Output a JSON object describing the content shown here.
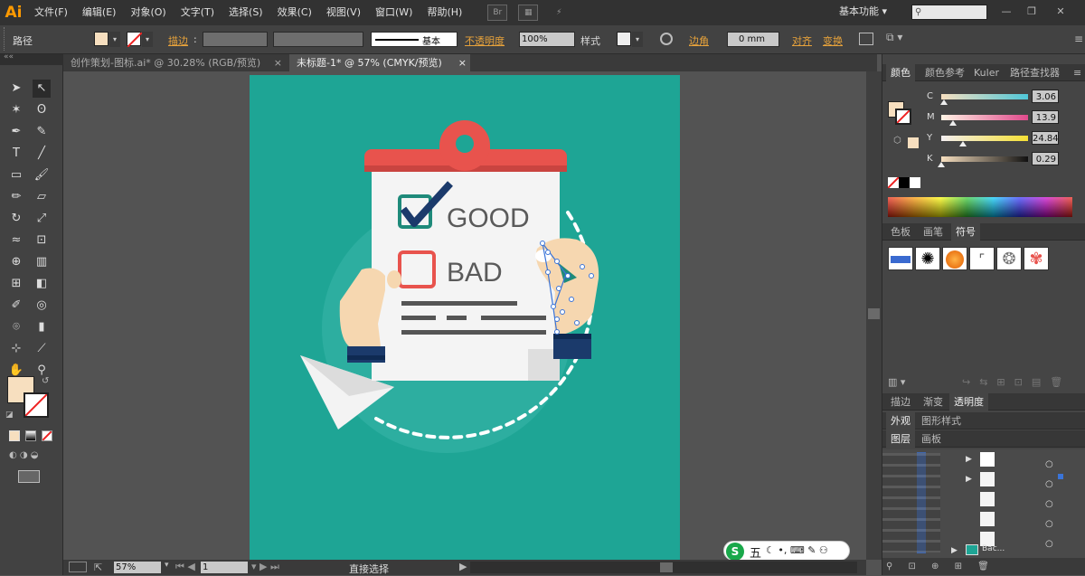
{
  "app": {
    "logo": "Ai"
  },
  "menu": [
    "文件(F)",
    "编辑(E)",
    "对象(O)",
    "文字(T)",
    "选择(S)",
    "效果(C)",
    "视图(V)",
    "窗口(W)",
    "帮助(H)"
  ],
  "menu_icons": {
    "bridge": "Br"
  },
  "workspace": {
    "label": "基本功能"
  },
  "control": {
    "selection_label": "路径",
    "stroke_label": "描边",
    "stroke_style_label": "基本",
    "opacity_label": "不透明度",
    "opacity_value": "100%",
    "style_label": "样式",
    "corner_label": "边角",
    "corner_value": "0 mm",
    "align_label": "对齐",
    "transform_label": "变换"
  },
  "tabs": [
    {
      "label": "创作策划-图标.ai* @ 30.28% (RGB/预览)",
      "close": "×"
    },
    {
      "label": "未标题-1* @ 57% (CMYK/预览)",
      "close": "×"
    }
  ],
  "colors": {
    "teal": "#1ea595",
    "fill_swatch": "#f7dfbf",
    "red_clip": "#e8534d",
    "skin": "#f6d7b0",
    "navy": "#1b3a6b",
    "check_green": "#1e8a7a"
  },
  "artwork": {
    "good_label": "GOOD",
    "bad_label": "BAD"
  },
  "color_panel": {
    "tabs": [
      "颜色",
      "颜色参考",
      "Kuler",
      "路径查找器"
    ],
    "channels": [
      {
        "name": "C",
        "value": "3.06",
        "pct": 3.06
      },
      {
        "name": "M",
        "value": "13.9",
        "pct": 13.9
      },
      {
        "name": "Y",
        "value": "24.84",
        "pct": 24.84
      },
      {
        "name": "K",
        "value": "0.29",
        "pct": 0.29
      }
    ]
  },
  "swatch_panel": {
    "tabs": [
      "色板",
      "画笔",
      "符号"
    ]
  },
  "stroke_panel": {
    "tabs": [
      "描边",
      "渐变",
      "透明度"
    ]
  },
  "appearance_panel": {
    "tabs": [
      "外观",
      "图形样式"
    ]
  },
  "layers_panel": {
    "tabs": [
      "图层",
      "画板"
    ],
    "last_row_label": "Bac..."
  },
  "status": {
    "zoom": "57%",
    "page": "1",
    "tool_name": "直接选择"
  },
  "ime": {
    "label": "五",
    "brand": "S"
  }
}
